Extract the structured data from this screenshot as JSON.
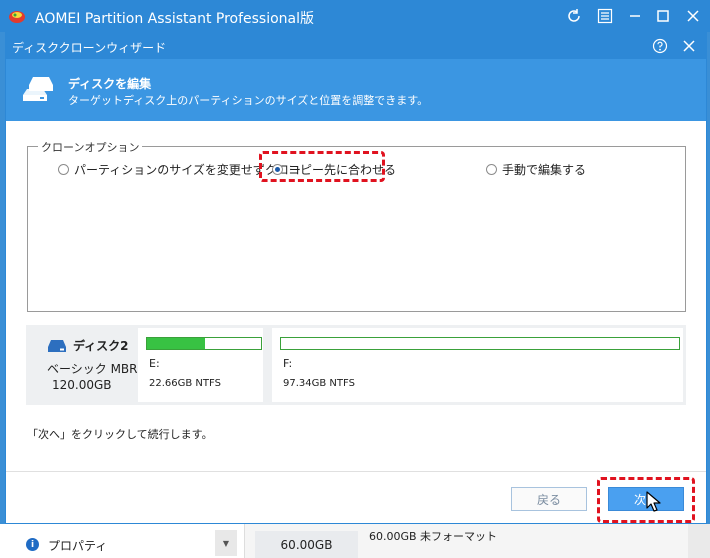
{
  "app": {
    "title": "AOMEI Partition Assistant Professional版"
  },
  "dialog": {
    "title": "ディスククローンウィザード",
    "banner_title": "ディスクを編集",
    "banner_subtitle": "ターゲットディスク上のパーティションのサイズと位置を調整できます。",
    "group_label": "クローンオプション",
    "options": [
      {
        "label": "パーティションのサイズを変更せずクロー",
        "selected": false
      },
      {
        "label": "コピー先に合わせる",
        "selected": true
      },
      {
        "label": "手動で編集する",
        "selected": false
      }
    ],
    "disk": {
      "name": "ディスク2",
      "type": "ベーシック MBR",
      "size": "120.00GB",
      "partitions": [
        {
          "letter": "E:",
          "detail": "22.66GB NTFS",
          "used_fraction": 0.51
        },
        {
          "letter": "F:",
          "detail": "97.34GB NTFS",
          "used_fraction": 0.0
        }
      ]
    },
    "hint": "「次へ」をクリックして続行します。",
    "back_label": "戻る",
    "next_label": "次へ"
  },
  "background": {
    "properties_label": "プロパティ",
    "disk_size": "60.00GB",
    "disk_desc": "60.00GB 未フォーマット"
  },
  "colors": {
    "titlebar": "#2d88d6",
    "banner": "#3b96e2",
    "highlight": "#e0121f",
    "partition_used": "#38c243"
  }
}
